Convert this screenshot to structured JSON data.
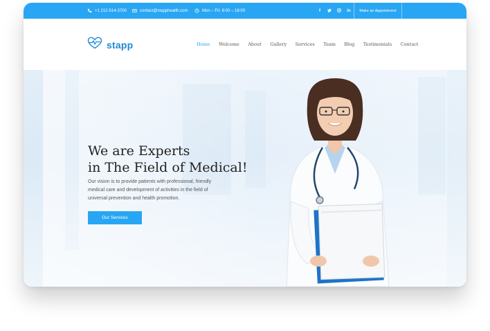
{
  "topbar": {
    "phone": "+1 212-514-3700",
    "email": "contact@stapphealth.com",
    "hours": "Mon – Fri: 8:00 – 18:00",
    "social": [
      "f",
      "t",
      "ig",
      "in"
    ],
    "appointment_label": "Make an Appointment"
  },
  "brand": {
    "name": "stapp",
    "color": "#1e88d6"
  },
  "nav": {
    "items": [
      "Home",
      "Welcome",
      "About",
      "Gallery",
      "Services",
      "Team",
      "Blog",
      "Testimonials",
      "Contact"
    ],
    "active": "Home"
  },
  "hero": {
    "title_line1": "We are Experts",
    "title_line2": "in The Field of Medical!",
    "description": "Our vision is to provide patients with professional, friendly medical care and development of activities in the field of universal prevention and health promotion.",
    "button_label": "Our Services"
  },
  "colors": {
    "accent": "#29a6f3",
    "heading": "#222222",
    "text": "#555555"
  },
  "icons": {
    "phone": "phone-icon",
    "email": "email-icon",
    "clock": "clock-icon",
    "logo": "heart-pulse-icon"
  }
}
